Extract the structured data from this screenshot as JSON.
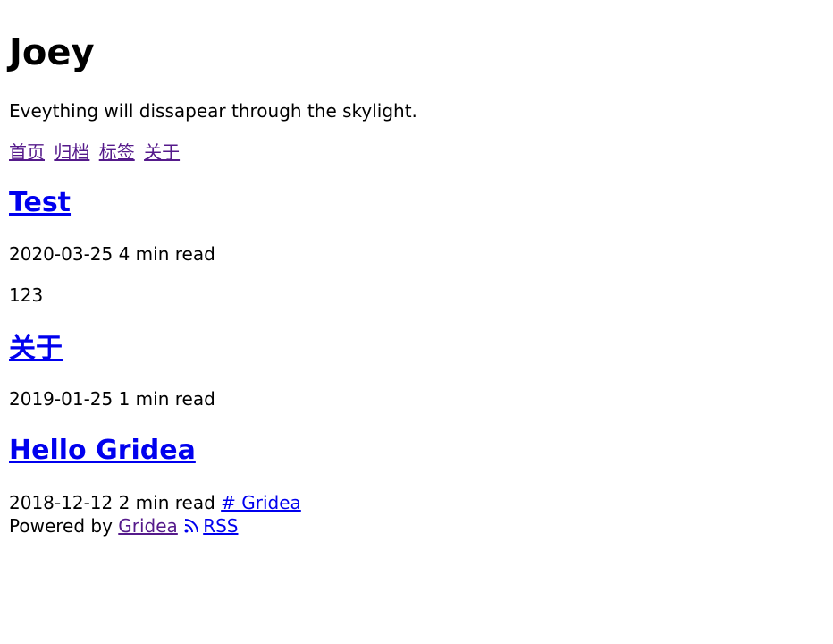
{
  "site": {
    "title": "Joey",
    "description": "Eveything will dissapear through the skylight."
  },
  "nav": {
    "items": [
      {
        "label": "首页"
      },
      {
        "label": "归档"
      },
      {
        "label": "标签"
      },
      {
        "label": "关于"
      }
    ]
  },
  "posts": [
    {
      "title": "Test",
      "date": "2020-03-25",
      "read_time": "4 min read",
      "excerpt": "123"
    },
    {
      "title": "关于",
      "date": "2019-01-25",
      "read_time": "1 min read"
    },
    {
      "title": "Hello Gridea",
      "date": "2018-12-12",
      "read_time": "2 min read",
      "tag": "# Gridea"
    }
  ],
  "footer": {
    "powered_by": "Powered by",
    "gridea_link": "Gridea",
    "rss_label": "RSS",
    "rss_icon": "rss-icon"
  },
  "colors": {
    "link": "#0000ee",
    "visited_link": "#551a8b",
    "text": "#000000",
    "background": "#ffffff"
  }
}
